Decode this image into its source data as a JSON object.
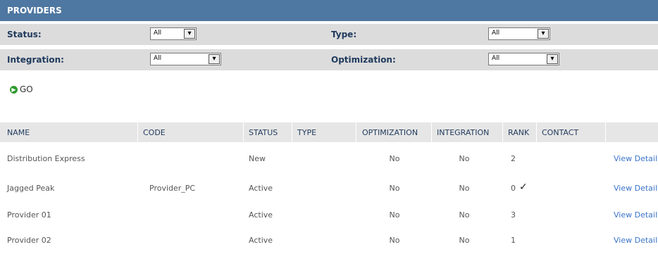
{
  "header": {
    "title": "PROVIDERS"
  },
  "filters": {
    "status": {
      "label": "Status:",
      "value": "All"
    },
    "type": {
      "label": "Type:",
      "value": "All"
    },
    "integration": {
      "label": "Integration:",
      "value": "All"
    },
    "optimization": {
      "label": "Optimization:",
      "value": "All"
    }
  },
  "go": {
    "label": "GO",
    "icon": "play-circle-icon"
  },
  "table": {
    "columns": [
      "NAME",
      "CODE",
      "STATUS",
      "TYPE",
      "OPTIMIZATION",
      "INTEGRATION",
      "RANK",
      "CONTACT",
      ""
    ],
    "rows": [
      {
        "name": "Distribution Express",
        "code": "",
        "status": "New",
        "type": "",
        "optimization": "No",
        "integration": "No",
        "rank": "2",
        "check": "",
        "contact": "",
        "action": "View Detail"
      },
      {
        "name": "Jagged Peak",
        "code": "Provider_PC",
        "status": "Active",
        "type": "",
        "optimization": "No",
        "integration": "No",
        "rank": "0",
        "check": "✓",
        "contact": "",
        "action": "View Detail"
      },
      {
        "name": "Provider 01",
        "code": "",
        "status": "Active",
        "type": "",
        "optimization": "No",
        "integration": "No",
        "rank": "3",
        "check": "",
        "contact": "",
        "action": "View Detail"
      },
      {
        "name": "Provider 02",
        "code": "",
        "status": "Active",
        "type": "",
        "optimization": "No",
        "integration": "No",
        "rank": "1",
        "check": "",
        "contact": "",
        "action": "View Detail"
      }
    ]
  },
  "colors": {
    "header_bg": "#4e77a1",
    "filter_bg": "#dcdcdc",
    "link": "#3a74c9",
    "label": "#1f3a5c"
  }
}
